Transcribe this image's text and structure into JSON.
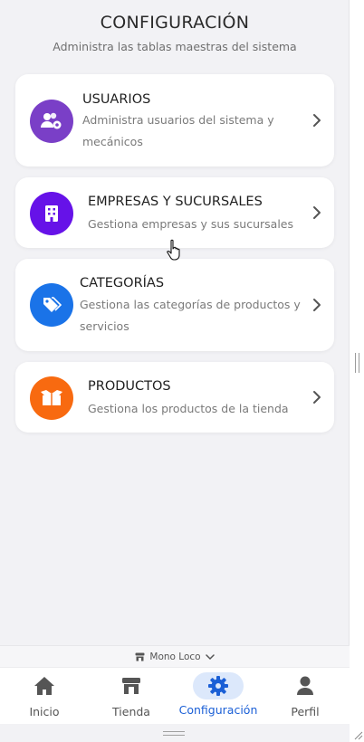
{
  "header": {
    "title": "CONFIGURACIÓN",
    "subtitle": "Administra las tablas maestras del sistema"
  },
  "cards": [
    {
      "title": "USUARIOS",
      "description_line1": "Administra usuarios del sistema y",
      "description_line2": "mecánicos",
      "icon": "users-gear-icon",
      "color": "#7a3fc7"
    },
    {
      "title": "EMPRESAS Y SUCURSALES",
      "description_line1": "Gestiona empresas y sus sucursales",
      "icon": "building-icon",
      "color": "#6612e8"
    },
    {
      "title": "CATEGORÍAS",
      "description_line1": "Gestiona las categorías de productos y",
      "description_line2": "servicios",
      "icon": "tags-icon",
      "color": "#1a73e8"
    },
    {
      "title": "PRODUCTOS",
      "description_line1": "Gestiona los productos de la tienda",
      "icon": "box-open-icon",
      "color": "#f86a10"
    }
  ],
  "store_selector": {
    "label": "Mono Loco",
    "icon": "store-icon"
  },
  "nav": {
    "items": [
      {
        "label": "Inicio",
        "icon": "home-icon"
      },
      {
        "label": "Tienda",
        "icon": "store-icon"
      },
      {
        "label": "Configuración",
        "icon": "gear-icon",
        "active": true
      },
      {
        "label": "Perfil",
        "icon": "user-icon"
      }
    ],
    "active_color": "#1a5fd6"
  }
}
